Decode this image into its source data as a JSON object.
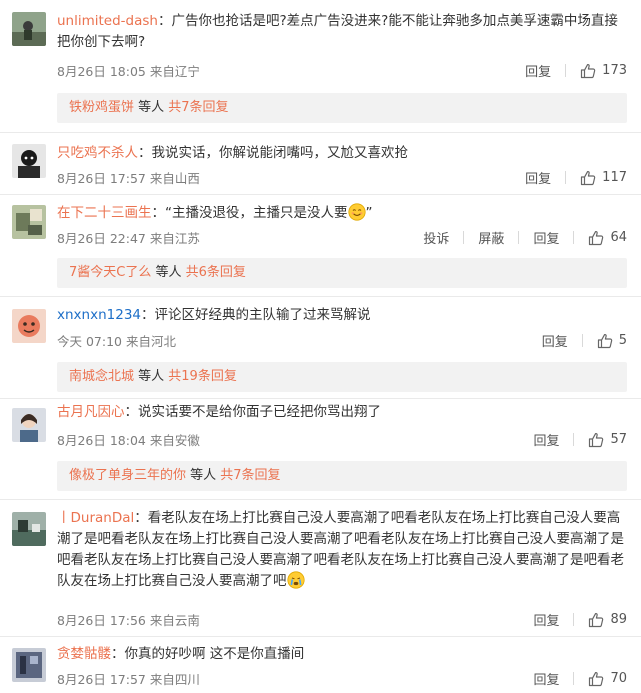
{
  "comments": [
    {
      "user": "unlimited-dash",
      "text": "：广告你也抢话是吧?差点广告没进来?能不能让奔驰多加点美孚速霸中场直接把你创下去啊?",
      "meta": "8月26日 18:05 来自辽宁",
      "reply_label": "回复",
      "likes": "173",
      "sub_user": "铁粉鸡蛋饼",
      "sub_middle": " 等人 ",
      "sub_count": "共7条回复"
    },
    {
      "user": "只吃鸡不杀人",
      "text": "：我说实话，你解说能闭嘴吗，又尬又喜欢抢",
      "meta": "8月26日 17:57 来自山西",
      "reply_label": "回复",
      "likes": "117"
    },
    {
      "user": "在下二十三画生",
      "text": "：“主播没退役，主播只是没人要",
      "text_end": "”",
      "meta": "8月26日 22:47 来自江苏",
      "report_label": "投诉",
      "block_label": "屏蔽",
      "reply_label": "回复",
      "likes": "64",
      "sub_user": "7酱今天C了么",
      "sub_middle": " 等人 ",
      "sub_count": "共6条回复"
    },
    {
      "user": "xnxnxn1234",
      "text": "：评论区好经典的主队输了过来骂解说",
      "meta": "今天 07:10 来自河北",
      "reply_label": "回复",
      "likes": "5",
      "sub_user": "南城念北城",
      "sub_middle": " 等人 ",
      "sub_count": "共19条回复"
    },
    {
      "user": "古月凡因心",
      "text": "：说实话要不是给你面子已经把你骂出翔了",
      "meta": "8月26日 18:04 来自安徽",
      "reply_label": "回复",
      "likes": "57",
      "sub_user": "像极了单身三年的你",
      "sub_middle": " 等人 ",
      "sub_count": "共7条回复"
    },
    {
      "user": "丨DuranDal",
      "text": "：看老队友在场上打比赛自己没人要高潮了吧看老队友在场上打比赛自己没人要高潮了是吧看老队友在场上打比赛自己没人要高潮了吧看老队友在场上打比赛自己没人要高潮了是吧看老队友在场上打比赛自己没人要高潮了吧看老队友在场上打比赛自己没人要高潮了是吧看老队友在场上打比赛自己没人要高潮了吧",
      "meta": "8月26日 17:56 来自云南",
      "reply_label": "回复",
      "likes": "89"
    },
    {
      "user": "贪婪骷髅",
      "text": "：你真的好吵啊 这不是你直播间",
      "meta": "8月26日 17:57 来自四川",
      "reply_label": "回复",
      "likes": "70"
    }
  ],
  "icons": {
    "like": "thumbs-up-icon",
    "smile": "smile-emoji-icon",
    "cry": "cry-emoji-icon"
  },
  "colors": {
    "username": "#eb7350",
    "username_alt": "#1e6fc8",
    "meta": "#7d7d7d",
    "reply_bg": "#f2f2f2"
  }
}
